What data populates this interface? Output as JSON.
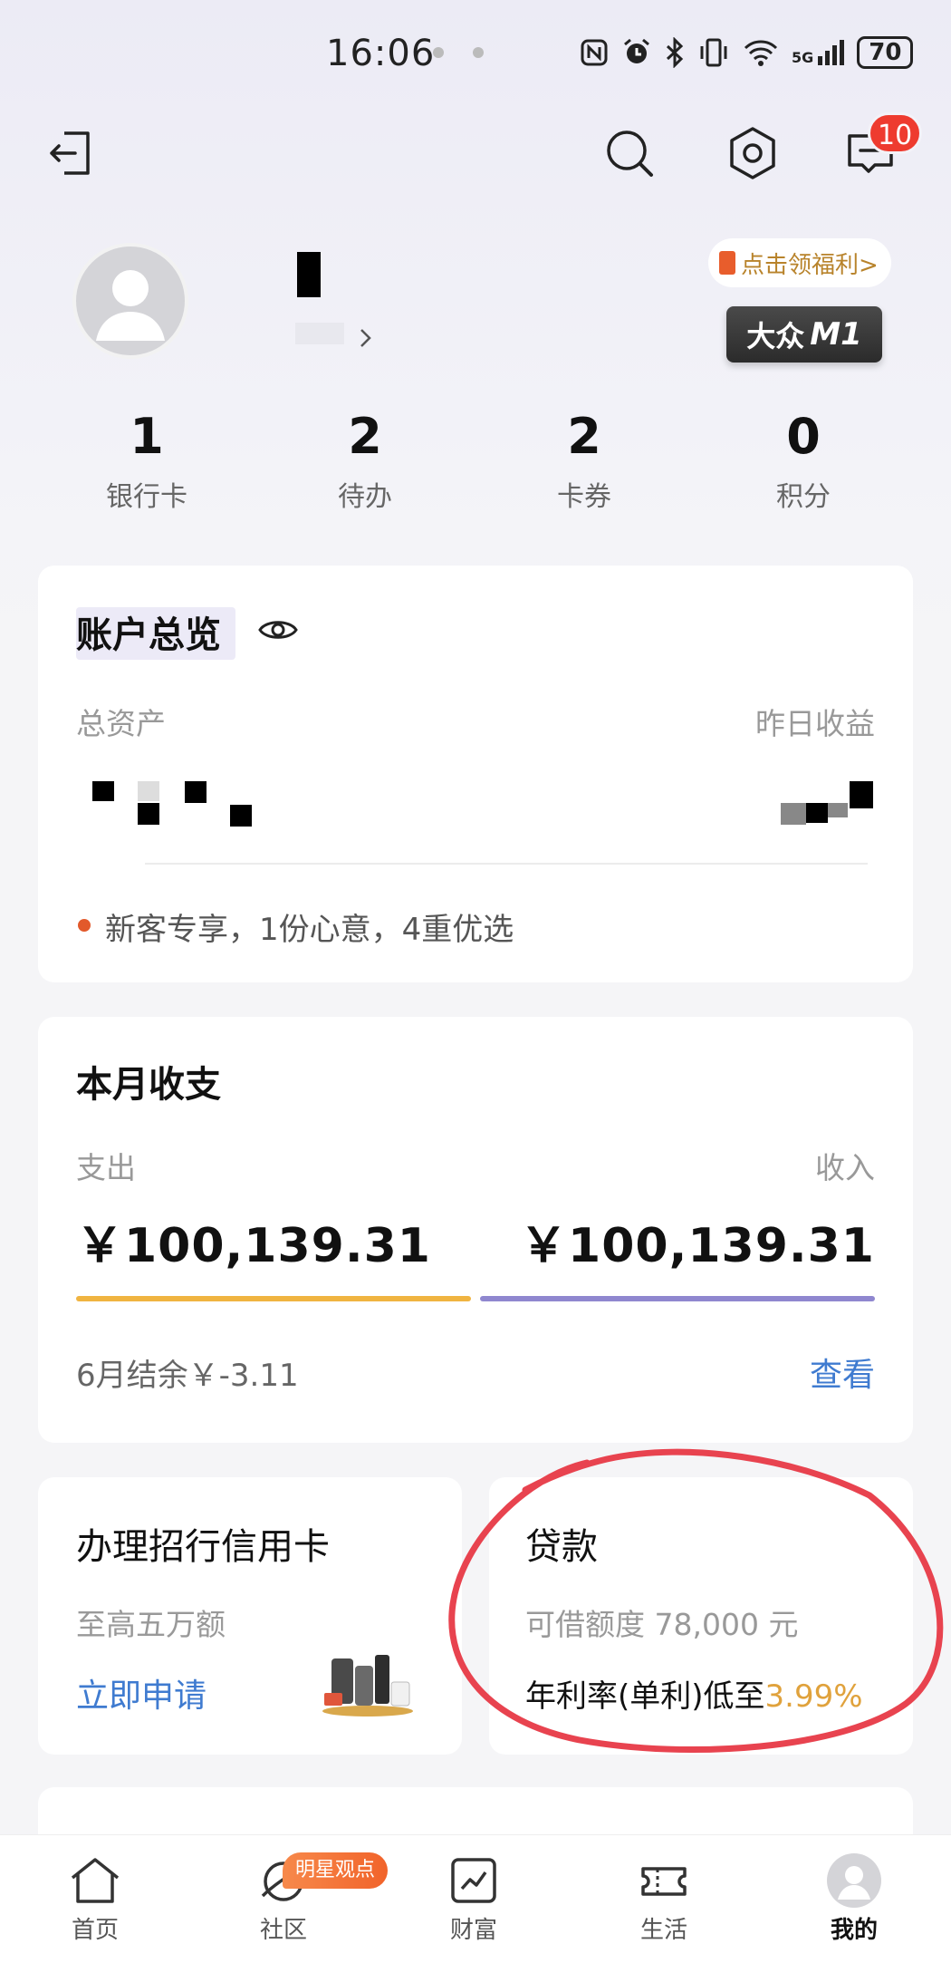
{
  "status_bar": {
    "time": "16:06",
    "battery": "70",
    "network": "5G"
  },
  "profile": {
    "welfare_label": "点击领福利>",
    "level_label": "大众",
    "level_code": "M1"
  },
  "header": {
    "message_badge": "10"
  },
  "stats": [
    {
      "value": "1",
      "label": "银行卡"
    },
    {
      "value": "2",
      "label": "待办"
    },
    {
      "value": "2",
      "label": "卡券"
    },
    {
      "value": "0",
      "label": "积分"
    }
  ],
  "account_overview": {
    "title": "账户总览",
    "total_assets_label": "总资产",
    "yesterday_income_label": "昨日收益",
    "promo": "新客专享，1份心意，4重优选"
  },
  "monthly": {
    "title": "本月收支",
    "expense_label": "支出",
    "income_label": "收入",
    "expense_value": "￥100,139.31",
    "income_value": "￥100,139.31",
    "balance": "6月结余￥-3.11",
    "view_label": "查看",
    "expense_color": "#f0b441",
    "income_color": "#8f87cf"
  },
  "credit_card": {
    "title": "办理招行信用卡",
    "subtitle": "至高五万额",
    "action": "立即申请"
  },
  "loan": {
    "title": "贷款",
    "limit": "可借额度 78,000 元",
    "rate_prefix": "年利率(单利)低至",
    "rate_value": "3.99%"
  },
  "bottom_nav": [
    {
      "label": "首页",
      "icon": "home-icon"
    },
    {
      "label": "社区",
      "icon": "community-icon",
      "badge": "明星观点"
    },
    {
      "label": "财富",
      "icon": "wealth-icon"
    },
    {
      "label": "生活",
      "icon": "life-icon"
    },
    {
      "label": "我的",
      "icon": "avatar-icon",
      "active": true
    }
  ]
}
